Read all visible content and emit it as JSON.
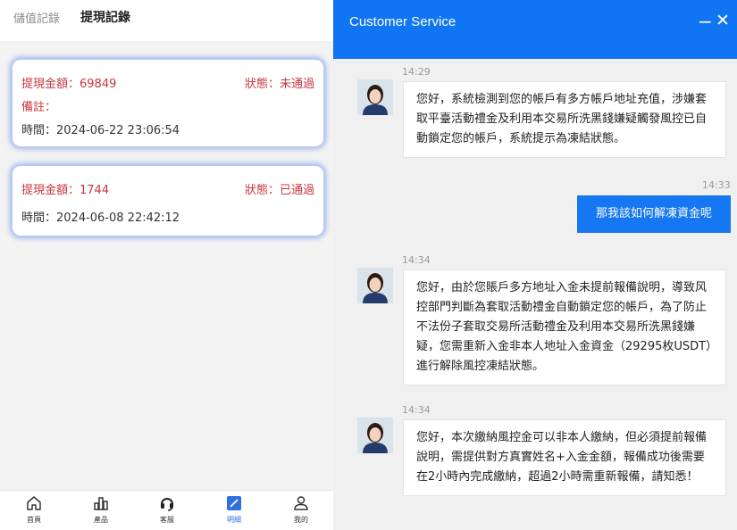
{
  "left": {
    "tabs": {
      "deposit": "儲值記錄",
      "withdraw": "提現記錄"
    },
    "records": [
      {
        "amount": "提現金額：69849",
        "status": "狀態：未通過",
        "note": "備註：",
        "time": "時間：2024-06-22 23:06:54"
      },
      {
        "amount": "提現金額：1744",
        "status": "狀態：已通過",
        "time": "時間：2024-06-08 22:42:12"
      }
    ],
    "nav": [
      {
        "label": "首頁",
        "icon": "home-icon"
      },
      {
        "label": "產品",
        "icon": "bar-chart-icon"
      },
      {
        "label": "客服",
        "icon": "headset-icon"
      },
      {
        "label": "明細",
        "icon": "details-icon"
      },
      {
        "label": "我的",
        "icon": "user-icon"
      }
    ],
    "colors": {
      "alert_red": "#c8363c",
      "active_blue": "#2f6fe0"
    }
  },
  "chat": {
    "title": "Customer Service",
    "minimize": "−",
    "close": "✕",
    "messages": [
      {
        "time": "14:29",
        "text": "您好，系統檢測到您的帳戶有多方帳戶地址充值，涉嫌套取平臺活動禮金及利用本交易所洗黑錢嫌疑觸發風控已自動鎖定您的帳戶，系統提示為凍結狀態。"
      },
      {
        "time": "14:33",
        "text": "那我該如何解凍資金呢"
      },
      {
        "time": "14:34",
        "text": "您好，由於您賬戶多方地址入金未提前報備說明，導致风控部門判斷為套取活動禮金自動鎖定您的帳戶，為了防止不法份子套取交易所活動禮金及利用本交易所洗黑錢嫌疑，您需重新入金非本人地址入金資金（29295枚USDT）進行解除風控凍結狀態。"
      },
      {
        "time": "14:34",
        "text": "您好，本次繳納風控金可以非本人繳納，但必須提前報備說明，需提供對方真實姓名+入金金額，報備成功後需要在2小時內完成繳納，超過2小時需重新報備，請知悉！"
      }
    ],
    "colors": {
      "header": "#0f75f3",
      "user_bubble": "#1677f2"
    }
  }
}
